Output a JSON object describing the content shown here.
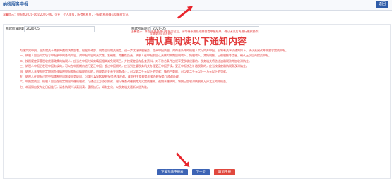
{
  "header": {
    "title": "纳税服务申报",
    "return_label": "返回"
  },
  "notice_top": "温馨提示：申报期2020-06至2020-06，企业，个人申报，所得税税目，已获取税款确认及缴款凭证。",
  "form": {
    "period_start_label": "税款所属期起",
    "period_start_value": "2020-05",
    "period_end_label": "税款所属期止",
    "period_end_value": "2020-05",
    "period_end_hint": "如需更正请点击此处"
  },
  "notice_mid": "温馨提示：如您选择并确认申报内容后，请等待系统处理并查看申报结果，确认无误后再进行缴款操作。",
  "headline": "请认真阅读以下通知内容",
  "body_paragraphs": [
    "为落实党中央、国务院关于减税降费的决策部署，根据财政部、税务总局相关规定，进一步优化纳税服务，提高申报质量，对符合条件的纳税人实行简并申报。现将有关事项通知如下，请认真阅读并按要求完成申报。",
    "一、纳税人应当如实填写申报表中的各项内容，对申报内容的真实性、准确性、完整性负责。纳税人在申报前应认真核对本期应税收入、免税收入、减免税额、已缴税额等信息，确认无误后再提交申报。",
    "二、按照规定享受税收优惠政策的纳税人，应当在申报时如实填报相关减免税项目，并按规定留存备查资料。对不符合条件违规享受税收优惠的，税务机关将依法追缴税款并加收滞纳金。",
    "三、纳税人申报后发现申报有误的，可以在申报期内进行更正申报；超过申报期的，应当到主管税务机关办理更正申报手续。更正申报涉及补缴税款的，应当按规定缴纳税款及滞纳金。",
    "四、纳税人未按照规定期限办理纳税申报和报送纳税资料的，由税务机关责令限期改正，可以处二千元以下的罚款；情节严重的，可以处二千元以上一万元以下的罚款。",
    "五、纳税人在申报过程中如遇系统问题或业务疑问，可拨打12366纳税服务热线咨询，或前往主管税务机关办税服务厅咨询办理。",
    "六、申报完成后，纳税人应当在规定期限内缴纳税款。可通过三方协议扣款、银行端查询缴税等方式完成缴款，逾期未缴纳的，将按日加收滞纳税款万分之五的滞纳金。",
    "七、本通知自发布之日起施行，请各纳税人认真阅读，遵照执行。如有变化，以税务机关最新公告为准。"
  ],
  "buttons": {
    "download_label": "下载预填申报表",
    "next_label": "下一步",
    "cancel_label": "取消申报"
  },
  "colors": {
    "accent_red": "#e23b3b",
    "arrow_red": "#e8252c",
    "button_blue": "#3d64b5",
    "button_red": "#e0483e"
  }
}
